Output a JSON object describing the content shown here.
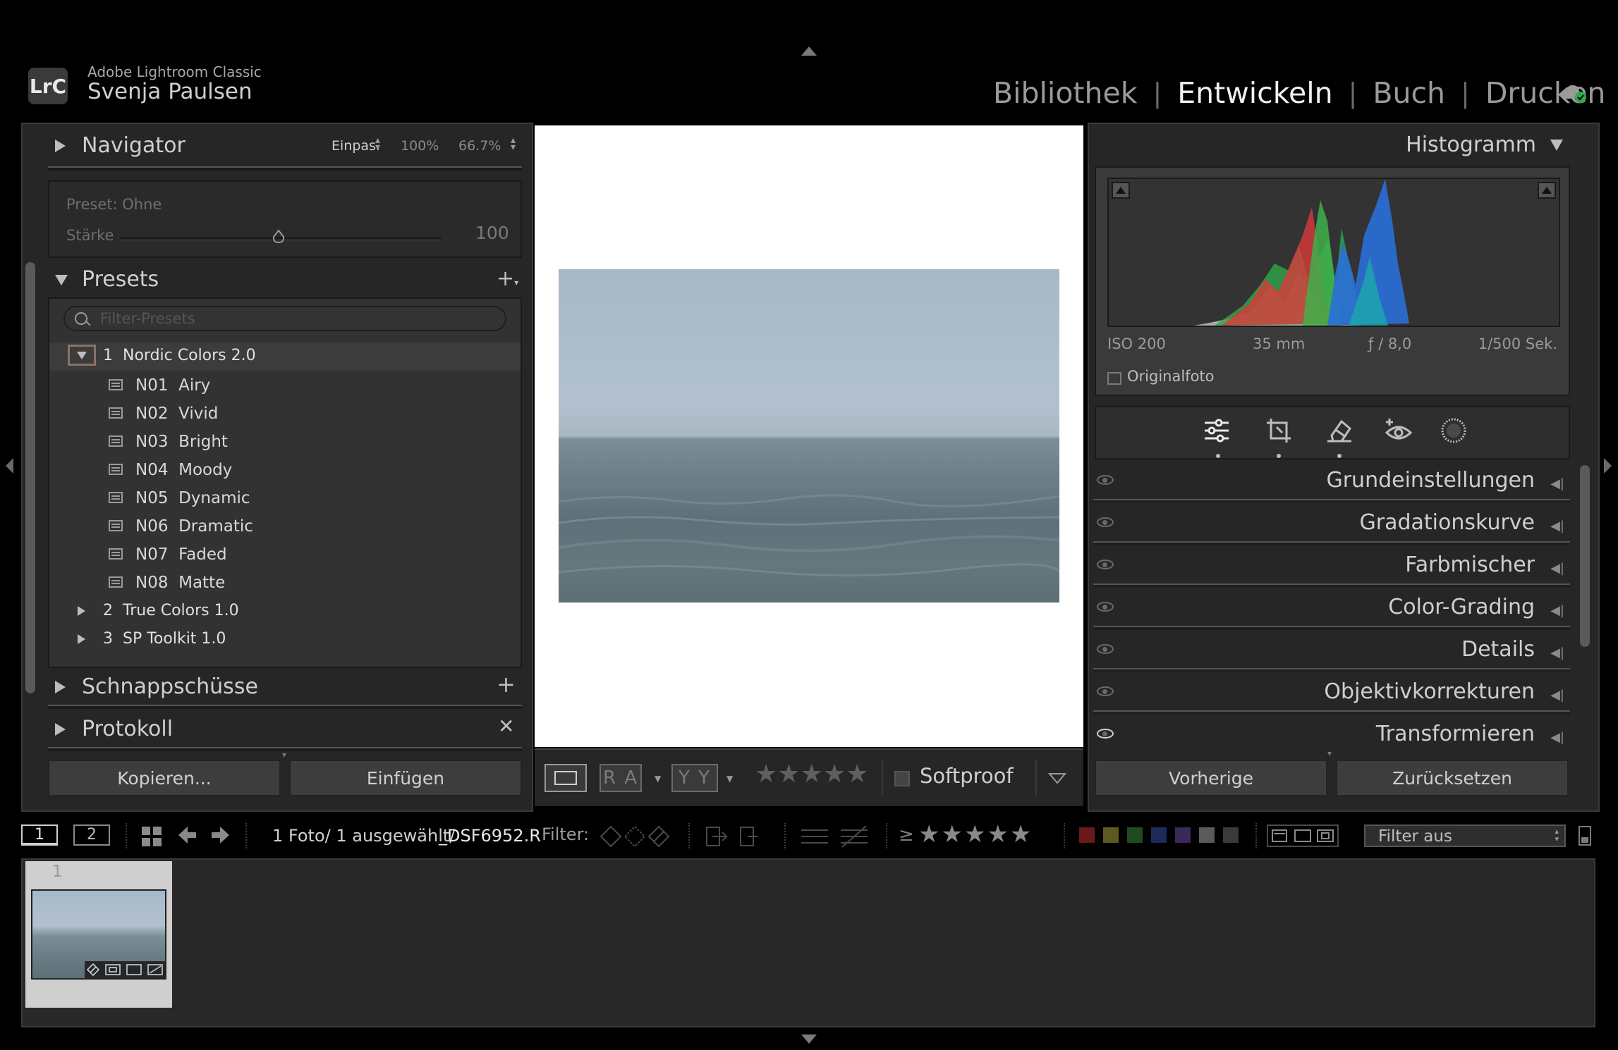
{
  "app": {
    "logo": "LrC",
    "product": "Adobe Lightroom Classic",
    "user": "Svenja Paulsen"
  },
  "modules": [
    "Bibliothek",
    "Entwickeln",
    "Buch",
    "Drucken"
  ],
  "active_module": "Entwickeln",
  "navigator": {
    "title": "Navigator",
    "fit": "Einpas.",
    "zoom1": "100%",
    "zoom2": "66.7%"
  },
  "preset_amount": {
    "preset_label": "Preset: Ohne",
    "amount_label": "Stärke",
    "amount_value": "100"
  },
  "presets": {
    "title": "Presets",
    "filter_placeholder": "Filter-Presets",
    "groups": [
      {
        "number": "1",
        "name": "Nordic Colors 2.0",
        "expanded": true,
        "items": [
          "N01  Airy",
          "N02  Vivid",
          "N03  Bright",
          "N04  Moody",
          "N05  Dynamic",
          "N06  Dramatic",
          "N07  Faded",
          "N08  Matte"
        ]
      },
      {
        "number": "2",
        "name": "True Colors 1.0",
        "expanded": false
      },
      {
        "number": "3",
        "name": "SP Toolkit 1.0",
        "expanded": false
      }
    ]
  },
  "snapshots": {
    "title": "Schnappschüsse"
  },
  "history": {
    "title": "Protokoll"
  },
  "left_buttons": {
    "copy": "Kopieren...",
    "paste": "Einfügen"
  },
  "toolbar": {
    "softproof": "Softproof",
    "before_after_ra": "R A",
    "before_after_yy": "Y Y",
    "stars": 0
  },
  "histogram": {
    "title": "Histogramm",
    "iso": "ISO 200",
    "focal": "35 mm",
    "aperture": "ƒ / 8,0",
    "shutter": "1/500 Sek.",
    "original": "Originalfoto"
  },
  "develop_panels": [
    "Grundeinstellungen",
    "Gradationskurve",
    "Farbmischer",
    "Color-Grading",
    "Details",
    "Objektivkorrekturen",
    "Transformieren"
  ],
  "right_buttons": {
    "previous": "Vorherige",
    "reset": "Zurücksetzen"
  },
  "filmstrip_bar": {
    "screen1": "1",
    "screen2": "2",
    "info_prefix": "1 Foto/ 1 ausgewählt/",
    "filename": "_DSF6952.R",
    "filter_label": "Filter:",
    "ge": "≥",
    "filter_select": "Filter aus"
  },
  "filmstrip": {
    "thumb_index": "1"
  },
  "colors": {
    "accent_red": "#d83a3a",
    "accent_green": "#2ea84a",
    "accent_blue": "#2a6fd8",
    "label_swatches": [
      "#6a1a1a",
      "#5c5a1e",
      "#1f4a1f",
      "#1f2a5c",
      "#3a2a5c",
      "#5a5a5a",
      "#3a3a3a"
    ]
  }
}
